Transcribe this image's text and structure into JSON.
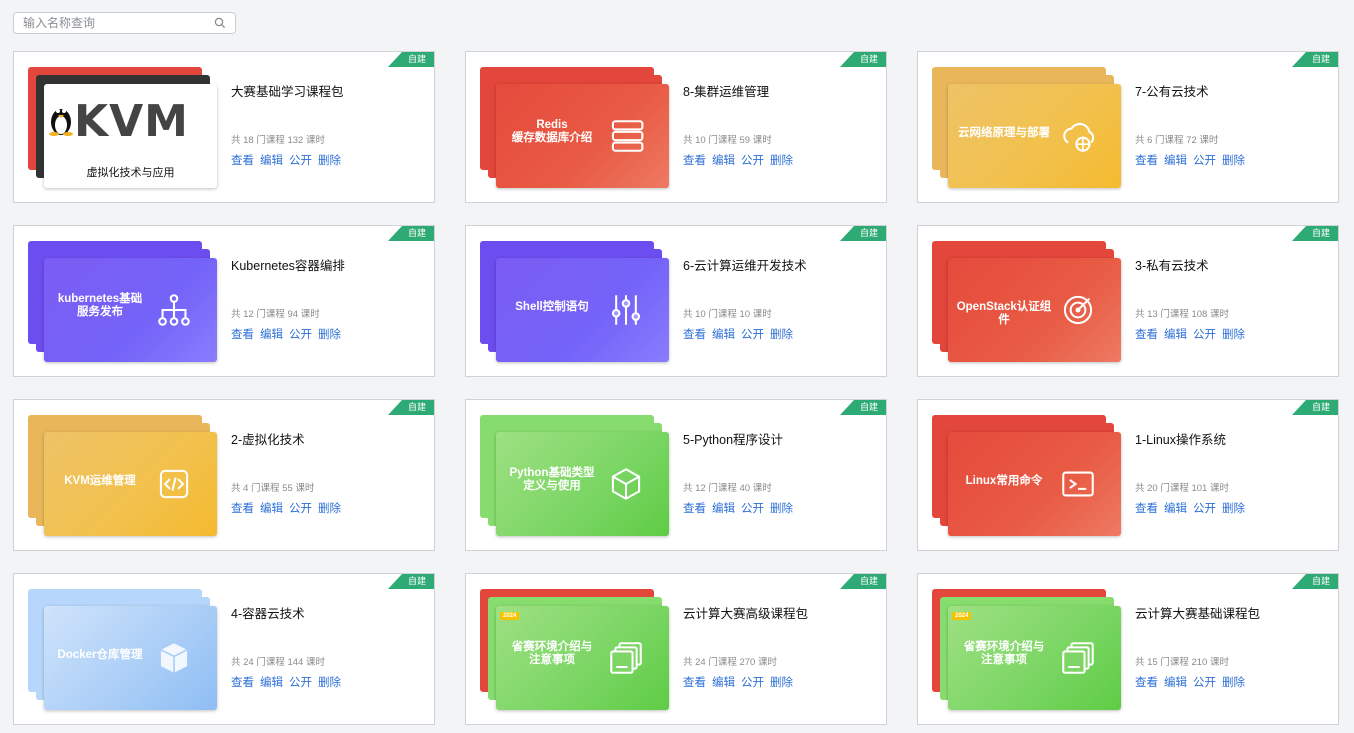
{
  "search": {
    "placeholder": "输入名称查询",
    "icon": "search-icon"
  },
  "colors": {
    "ribbon": "#2eaa74",
    "link": "#2d6fd6",
    "red": "#e64a3c",
    "orange": "#f2c14b",
    "purple": "#7463f8",
    "green": "#79d562",
    "blue": "#a9cdf6"
  },
  "actions": {
    "view": "查看",
    "edit": "编辑",
    "publish": "公开",
    "delete": "删除"
  },
  "cards": [
    {
      "badge": "自建",
      "title": "大赛基础学习课程包",
      "meta": "共 18 门课程 132 课时",
      "cover_text": "虚拟化技术与应用",
      "cover_logo": "KVM",
      "theme": "kvm"
    },
    {
      "badge": "自建",
      "title": "8-集群运维管理",
      "meta": "共 10 门课程 59 课时",
      "cover_text": "Redis\n缓存数据库介绍",
      "theme": "red",
      "icon": "redis-icon"
    },
    {
      "badge": "自建",
      "title": "7-公有云技术",
      "meta": "共 6 门课程 72 课时",
      "cover_text": "云网络原理与部署",
      "theme": "orange",
      "icon": "cloud-globe-icon"
    },
    {
      "badge": "自建",
      "title": "Kubernetes容器编排",
      "meta": "共 12 门课程 94 课时",
      "cover_text": "kubernetes基础\n服务发布",
      "theme": "purple",
      "icon": "tree-network-icon"
    },
    {
      "badge": "自建",
      "title": "6-云计算运维开发技术",
      "meta": "共 10 门课程 10 课时",
      "cover_text": "Shell控制语句",
      "theme": "purple",
      "icon": "sliders-icon"
    },
    {
      "badge": "自建",
      "title": "3-私有云技术",
      "meta": "共 13 门课程 108 课时",
      "cover_text": "OpenStack认证组件",
      "theme": "red",
      "icon": "target-icon"
    },
    {
      "badge": "自建",
      "title": "2-虚拟化技术",
      "meta": "共 4 门课程 55 课时",
      "cover_text": "KVM运维管理",
      "theme": "orange",
      "icon": "code-icon"
    },
    {
      "badge": "自建",
      "title": "5-Python程序设计",
      "meta": "共 12 门课程 40 课时",
      "cover_text": "Python基础类型\n定义与使用",
      "theme": "green",
      "icon": "cube-icon"
    },
    {
      "badge": "自建",
      "title": "1-Linux操作系统",
      "meta": "共 20 门课程 101 课时",
      "cover_text": "Linux常用命令",
      "theme": "red",
      "icon": "terminal-icon"
    },
    {
      "badge": "自建",
      "title": "4-容器云技术",
      "meta": "共 24 门课程 144 课时",
      "cover_text": "Docker仓库管理",
      "theme": "blue",
      "icon": "box-icon"
    },
    {
      "badge": "自建",
      "title": "云计算大赛高级课程包",
      "meta": "共 24 门课程 270 课时",
      "cover_text": "省赛环境介绍与\n注意事项",
      "theme": "green-red",
      "icon": "stack-icon",
      "year": "2024"
    },
    {
      "badge": "自建",
      "title": "云计算大赛基础课程包",
      "meta": "共 15 门课程 210 课时",
      "cover_text": "省赛环境介绍与\n注意事项",
      "theme": "green-red",
      "icon": "stack-icon",
      "year": "2024"
    }
  ]
}
